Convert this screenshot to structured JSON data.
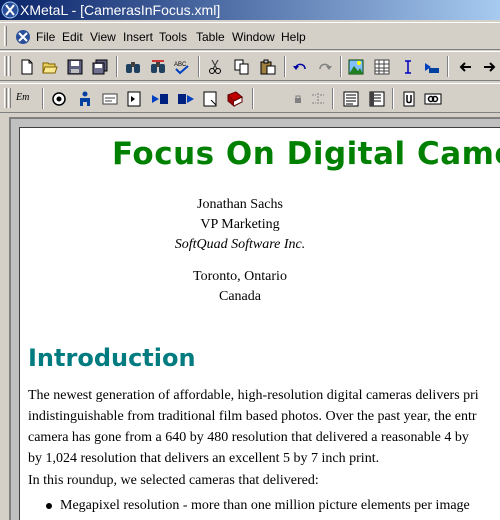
{
  "window": {
    "title": "XMetaL - [CamerasInFocus.xml]"
  },
  "menu": {
    "items": [
      "File",
      "Edit",
      "View",
      "Insert",
      "Tools",
      "Table",
      "Window",
      "Help"
    ]
  },
  "toolbar1": {
    "icons": [
      "new-icon",
      "open-icon",
      "save-icon",
      "save-all-icon",
      "find-icon",
      "find-replace-icon",
      "spellcheck-icon",
      "cut-icon",
      "copy-icon",
      "paste-icon",
      "undo-icon",
      "redo-icon",
      "insert-image-icon",
      "insert-table-icon",
      "text-cursor-icon",
      "element-icon",
      "back-arrow-icon",
      "forward-arrow-icon"
    ]
  },
  "toolbar2": {
    "em_label": "Em",
    "icons": [
      "element-list-icon",
      "person-icon",
      "form-icon",
      "page-icon",
      "move-right-icon",
      "next-icon",
      "flag-icon",
      "book-icon",
      "lock-icon",
      "split-icon",
      "tags-view-icon",
      "normal-view-icon",
      "plain-view-icon",
      "link-icon"
    ]
  },
  "document": {
    "title": "Focus On Digital Came",
    "author": "Jonathan Sachs",
    "position": "VP Marketing",
    "company": "SoftQuad Software Inc.",
    "city": "Toronto, Ontario",
    "country": "Canada",
    "section_heading": "Introduction",
    "paragraph1_lines": [
      "The newest generation of affordable, high-resolution digital cameras delivers pri",
      "indistinguishable from traditional film based photos. Over the past year, the entr",
      "camera has gone from a 640 by 480 resolution that delivered a reasonable 4 by",
      "by 1,024 resolution that delivers an excellent 5 by 7 inch print."
    ],
    "paragraph2": "In this roundup, we selected cameras that delivered:",
    "bullet1": "Megapixel resolution - more than one million picture elements per image"
  }
}
